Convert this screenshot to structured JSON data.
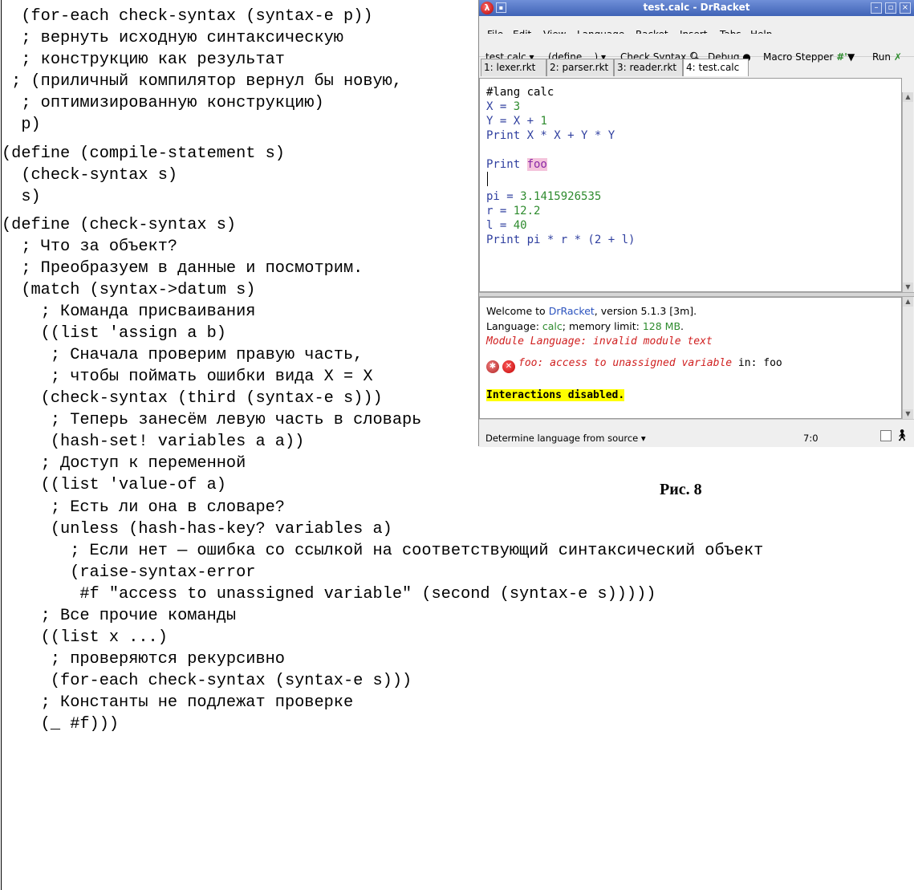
{
  "code_lines": [
    "  (for-each check-syntax (syntax-e p))",
    "  ; вернуть исходную синтаксическую",
    "  ; конструкцию как результат",
    " ; (приличный компилятор вернул бы новую,",
    "  ; оптимизированную конструкцию)",
    "  p)",
    "(define (compile-statement s)",
    "  (check-syntax s)",
    "  s)",
    "(define (check-syntax s)",
    "  ; Что за объект?",
    "  ; Преобразуем в данные и посмотрим.",
    "  (match (syntax->datum s)",
    "    ; Команда присваивания",
    "    ((list 'assign a b)",
    "     ; Сначала проверим правую часть,",
    "     ; чтобы поймать ошибки вида X = X",
    "    (check-syntax (third (syntax-e s)))",
    "     ; Теперь занесём левую часть в словарь",
    "     (hash-set! variables a a))",
    "    ; Доступ к переменной",
    "    ((list 'value-of a)",
    "     ; Есть ли она в словаре?",
    "     (unless (hash-has-key? variables a)",
    "       ; Если нет — ошибка со ссылкой на соответствующий синтаксический объект",
    "       (raise-syntax-error",
    "        #f \"access to unassigned variable\" (second (syntax-e s)))))",
    "    ; Все прочие команды",
    "    ((list x ...)",
    "     ; проверяются рекурсивно",
    "     (for-each check-syntax (syntax-e s)))",
    "    ; Константы не подлежат проверке",
    "    (_ #f)))"
  ],
  "window": {
    "title": "test.calc - DrRacket",
    "menu": [
      "File",
      "Edit",
      "View",
      "Language",
      "Racket",
      "Insert",
      "Tabs",
      "Help"
    ],
    "toolbar": {
      "file_dropdown": "test.calc ▾",
      "define_dropdown": "(define ...) ▾",
      "check_syntax": "Check Syntax",
      "debug": "Debug",
      "macro_stepper": "Macro Stepper",
      "macro_stepper_mark": "#'",
      "run": "Run"
    },
    "tabs": [
      "1: lexer.rkt",
      "2: parser.rkt",
      "3: reader.rkt",
      "4: test.calc"
    ],
    "editor": {
      "lang_line": "#lang calc",
      "x_assign": {
        "name": "X",
        "op": " = ",
        "value": "3"
      },
      "y_assign": {
        "left": "Y",
        "op": " = ",
        "x": "X",
        "plus": " + ",
        "value": "1"
      },
      "print1": "Print X * X + Y * Y",
      "print_foo_kw": "Print ",
      "print_foo_var": "foo",
      "pi_assign": {
        "name": "pi",
        "op": " = ",
        "value": "3.1415926535"
      },
      "r_assign": {
        "name": "r",
        "op": " = ",
        "value": "12.2"
      },
      "l_assign": {
        "name": "l",
        "op": " = ",
        "value": "40"
      },
      "print2": "Print pi * r * (2 + l)"
    },
    "repl": {
      "welcome_prefix": "Welcome to ",
      "welcome_link": "DrRacket",
      "welcome_suffix": ", version 5.1.3 [3m].",
      "language_prefix": "Language: ",
      "language_value": "calc",
      "language_suffix": "; memory limit: ",
      "memory_value": "128 MB",
      "memory_suffix": ".",
      "module_error": "Module Language: invalid module text",
      "access_error": "foo: access to unassigned variable",
      "access_in": " in: foo",
      "disabled": "Interactions disabled."
    },
    "status": {
      "language_selector": "Determine language from source ▾",
      "position": "7:0"
    }
  },
  "figure_caption": "Рис. 8",
  "colors": {
    "keyword_blue": "#2f3f9f",
    "number_green": "#2e8b2e",
    "error_red": "#d02020",
    "highlight_yellow": "#ffff00",
    "title_bar_blue": "#3f63b6"
  }
}
